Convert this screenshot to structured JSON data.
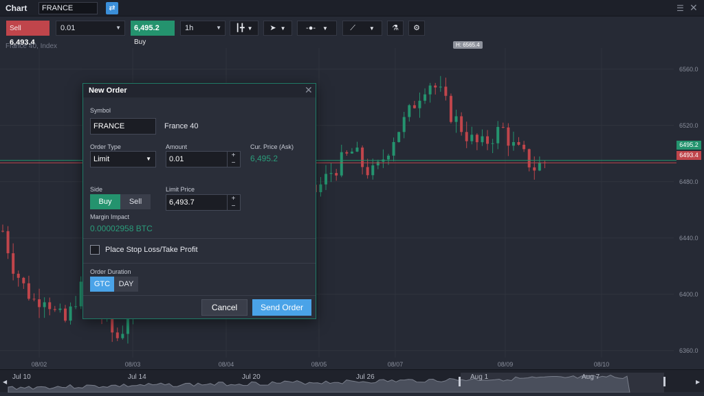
{
  "window": {
    "title": "Chart",
    "symbol": "FRANCE"
  },
  "toolbar": {
    "sell_label": "Sell",
    "sell_price": "6,493.4",
    "quantity": "0.01",
    "buy_price": "6,495.2",
    "buy_label": "Buy",
    "timeframe": "1h"
  },
  "chart": {
    "instrument_label": "France 40, Index",
    "high_label": "H: 6565.4",
    "ask_tag": "6495.2",
    "bid_tag": "6493.4",
    "colors": {
      "up": "#24936e",
      "down": "#c0454b",
      "background": "#262a35"
    }
  },
  "chart_data": {
    "type": "candlestick",
    "y_ticks": [
      "6560.0",
      "6520.0",
      "6480.0",
      "6440.0",
      "6400.0",
      "6360.0"
    ],
    "ylim": [
      6355,
      6575
    ],
    "x_ticks": [
      "08/02",
      "08/03",
      "08/04",
      "08/05",
      "08/07",
      "08/09",
      "08/10"
    ],
    "ask_price": 6495.2,
    "bid_price": 6493.4,
    "high": 6565.4,
    "grid": true
  },
  "navigator": {
    "labels": [
      "Jul 10",
      "Jul 14",
      "Jul 20",
      "Jul 26",
      "Aug 1",
      "Aug 7"
    ]
  },
  "order_dialog": {
    "title": "New Order",
    "symbol_label": "Symbol",
    "symbol_value": "FRANCE",
    "symbol_name": "France 40",
    "order_type_label": "Order Type",
    "order_type_value": "Limit",
    "amount_label": "Amount",
    "amount_value": "0.01",
    "cur_price_label": "Cur. Price (Ask)",
    "cur_price_value": "6,495.2",
    "side_label": "Side",
    "side_buy": "Buy",
    "side_sell": "Sell",
    "limit_price_label": "Limit Price",
    "limit_price_value": "6,493.7",
    "margin_label": "Margin Impact",
    "margin_value": "0.00002958 BTC",
    "stop_loss_label": "Place Stop Loss/Take Profit",
    "duration_label": "Order Duration",
    "duration_gtc": "GTC",
    "duration_day": "DAY",
    "cancel_label": "Cancel",
    "send_label": "Send Order"
  }
}
